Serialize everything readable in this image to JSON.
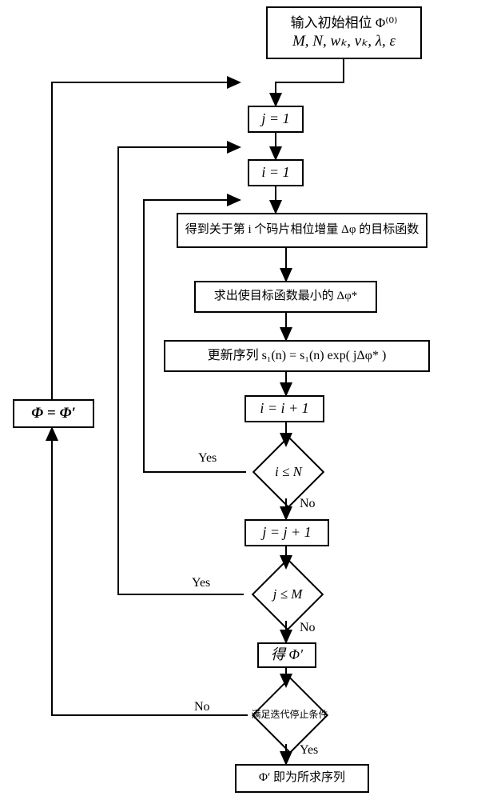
{
  "flow": {
    "input_box_line1": "输入初始相位 Φ⁽⁰⁾",
    "input_box_line2": "M, N, wₖ, vₖ, λ, ε",
    "assign_j_1": "j = 1",
    "assign_i_1": "i = 1",
    "objective": "得到关于第 i 个码片相位增量 Δφ 的目标函数",
    "min_step": "求出使目标函数最小的 Δφ*",
    "update_seq": "更新序列 s₁(n) = s₁(n) exp( jΔφ* )",
    "inc_i": "i = i + 1",
    "cond_iN": "i ≤ N",
    "inc_j": "j = j + 1",
    "cond_jM": "j ≤ M",
    "get_phi_prime": "得 Φ′",
    "cond_stop": "满足迭代停止条件",
    "result": "Φ′ 即为所求序列",
    "loop_back_assign": "Φ = Φ′",
    "yes": "Yes",
    "no": "No"
  }
}
